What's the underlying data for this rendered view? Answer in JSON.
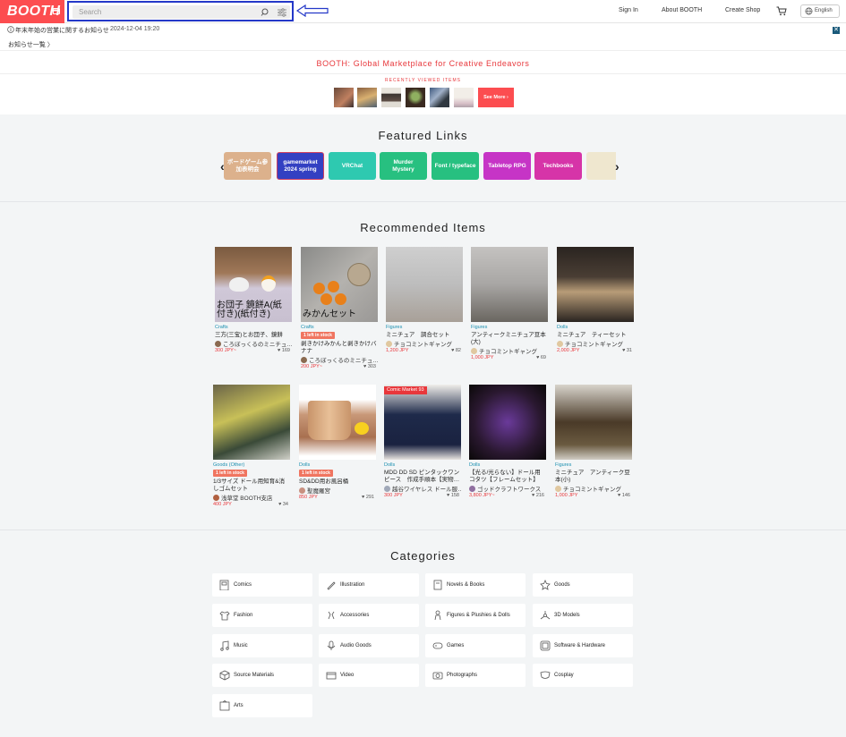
{
  "header": {
    "logo": "BOOTH",
    "search_placeholder": "Search",
    "sign_in": "Sign In",
    "about": "About BOOTH",
    "create_shop": "Create Shop",
    "language": "English"
  },
  "notice": {
    "text": "年末年始の営業に関するお知らせ",
    "date": "2024-12-04 19:20",
    "all_news": "お知らせ一覧 〉"
  },
  "tagline": "BOOTH: Global Marketplace for Creative Endeavors",
  "recently_viewed": {
    "title": "RECENTLY VIEWED ITEMS",
    "see_more": "See More ›"
  },
  "featured": {
    "title": "Featured Links",
    "links": [
      {
        "label": "ボードゲーム参加表明会",
        "color": "#d9a67a"
      },
      {
        "label": "gamemarket 2024 spring",
        "color": "#3340c2"
      },
      {
        "label": "VRChat",
        "color": "#2ec9b0"
      },
      {
        "label": "Murder Mystery",
        "color": "#27c080"
      },
      {
        "label": "Font / typeface",
        "color": "#27c080"
      },
      {
        "label": "Tabletop RPG",
        "color": "#c634c6"
      },
      {
        "label": "Techbooks",
        "color": "#d634a8"
      },
      {
        "label": "",
        "color": "#efe7cf"
      }
    ]
  },
  "recommended": {
    "title": "Recommended Items",
    "items": [
      {
        "cat": "Crafts",
        "stock": "",
        "name": "三方(三宝)とお団子、鏡餅",
        "shop": "ころぼっくるのミニチュ…",
        "price": "300 JPY~",
        "likes": "169"
      },
      {
        "cat": "Crafts",
        "stock": "1 left in stock",
        "name": "剥きかけみかんと剥きかけバナナ",
        "shop": "ころぼっくるのミニチュ…",
        "price": "200 JPY~",
        "likes": "303"
      },
      {
        "cat": "Figures",
        "stock": "",
        "name": "ミニチュア　調合セット",
        "shop": "チョコミントギャング",
        "price": "1,200 JPY",
        "likes": "82"
      },
      {
        "cat": "Figures",
        "stock": "",
        "name": "アンティークミニチュア豆本(大)",
        "shop": "チョコミントギャング",
        "price": "1,000 JPY",
        "likes": "69"
      },
      {
        "cat": "Dolls",
        "stock": "",
        "name": "ミニチュア　ティーセット",
        "shop": "チョコミントギャング",
        "price": "2,000 JPY",
        "likes": "31"
      },
      {
        "cat": "Goods (Other)",
        "stock": "1 left in stock",
        "name": "1/3サイズ ドール用知育&消しゴムセット",
        "shop": "浅草堂 BOOTH支店",
        "price": "400 JPY",
        "likes": "34"
      },
      {
        "cat": "Dolls",
        "stock": "1 left in stock",
        "name": "SD&DD用お風呂桶",
        "shop": "聖魔羅宮",
        "price": "850 JPY",
        "likes": "291"
      },
      {
        "cat": "Dolls",
        "stock": "",
        "name": "MDD DD SD ピンタックワンピース　作成手順本【実物…",
        "shop": "越谷ワイヤレス ドール服…",
        "price": "300 JPY",
        "likes": "158",
        "badge": "Comic Market 93"
      },
      {
        "cat": "Dolls",
        "stock": "",
        "name": "【光る/光らない】ドール用コタツ【フレームセット】",
        "shop": "ゴッドクラフトワークス",
        "price": "3,800 JPY~",
        "likes": "216"
      },
      {
        "cat": "Figures",
        "stock": "",
        "name": "ミニチュア　アンティーク豆本(小)",
        "shop": "チョコミントギャング",
        "price": "1,000 JPY",
        "likes": "146"
      }
    ]
  },
  "categories": {
    "title": "Categories",
    "items": [
      {
        "label": "Comics",
        "icon": "comics-icon"
      },
      {
        "label": "Illustration",
        "icon": "illustration-icon"
      },
      {
        "label": "Novels & Books",
        "icon": "book-icon"
      },
      {
        "label": "Goods",
        "icon": "star-icon"
      },
      {
        "label": "Fashion",
        "icon": "shirt-icon"
      },
      {
        "label": "Accessories",
        "icon": "accessories-icon"
      },
      {
        "label": "Figures & Plushies & Dolls",
        "icon": "figure-icon"
      },
      {
        "label": "3D Models",
        "icon": "3d-model-icon"
      },
      {
        "label": "Music",
        "icon": "music-icon"
      },
      {
        "label": "Audio Goods",
        "icon": "microphone-icon"
      },
      {
        "label": "Games",
        "icon": "gamepad-icon"
      },
      {
        "label": "Software & Hardware",
        "icon": "chip-icon"
      },
      {
        "label": "Source Materials",
        "icon": "cube-icon"
      },
      {
        "label": "Video",
        "icon": "video-icon"
      },
      {
        "label": "Photographs",
        "icon": "camera-icon"
      },
      {
        "label": "Cosplay",
        "icon": "cosplay-icon"
      },
      {
        "label": "Arts",
        "icon": "frame-icon"
      }
    ]
  },
  "item_image_captions": {
    "item0": "お団子 鏡餅A(紙付き)(紙付き)",
    "item1": "みかんセット"
  }
}
